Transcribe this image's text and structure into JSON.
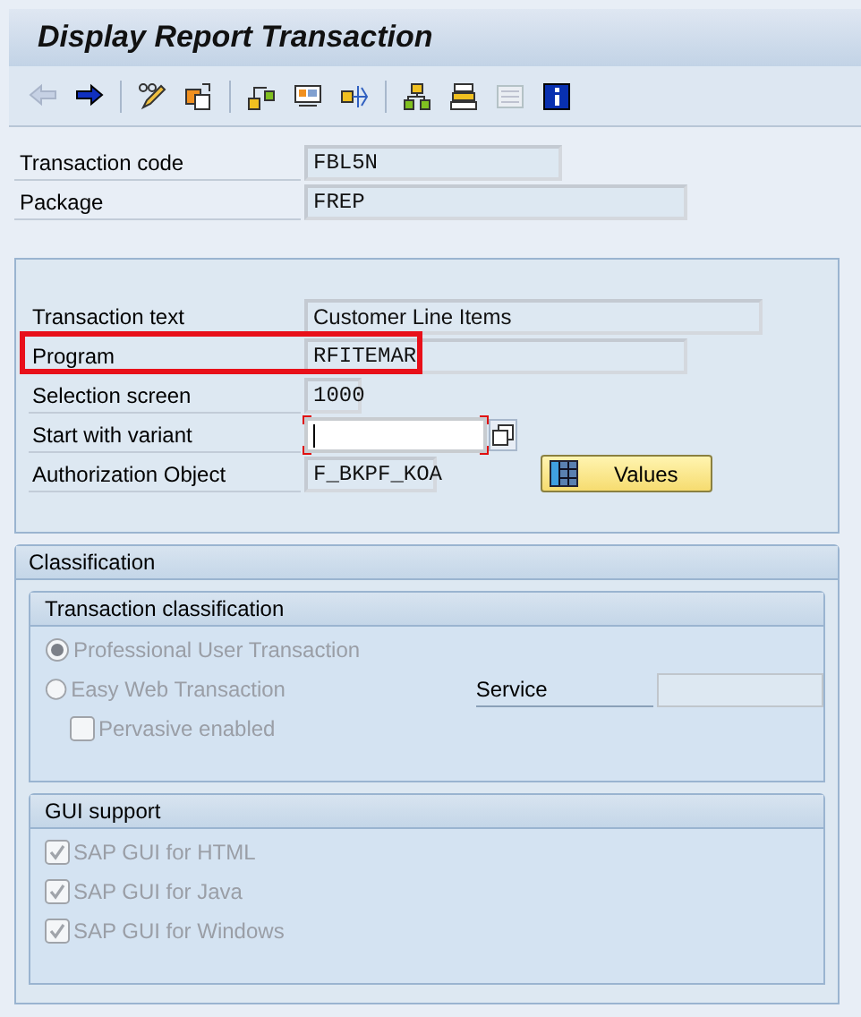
{
  "window": {
    "title": "Display Report Transaction"
  },
  "toolbar": [
    {
      "kind": "back",
      "disabled": true
    },
    {
      "kind": "forward",
      "disabled": false
    },
    {
      "kind": "sep"
    },
    {
      "kind": "edit",
      "disabled": false
    },
    {
      "kind": "other",
      "disabled": false
    },
    {
      "kind": "sep"
    },
    {
      "kind": "tree",
      "disabled": false
    },
    {
      "kind": "screen",
      "disabled": false
    },
    {
      "kind": "branch",
      "disabled": false
    },
    {
      "kind": "sep"
    },
    {
      "kind": "hierarchy",
      "disabled": false
    },
    {
      "kind": "stack",
      "disabled": false
    },
    {
      "kind": "list",
      "disabled": true
    },
    {
      "kind": "info",
      "disabled": false
    }
  ],
  "header_fields": [
    {
      "label": "Transaction code",
      "value": "FBL5N"
    },
    {
      "label": "Package",
      "value": "FREP"
    }
  ],
  "details": [
    {
      "kind": "text",
      "label": "Transaction text",
      "value": "Customer Line Items",
      "highlighted": false
    },
    {
      "kind": "code",
      "label": "Program",
      "value": "RFITEMAR",
      "highlighted": true
    },
    {
      "kind": "code",
      "label": "Selection screen",
      "value": "1000",
      "highlighted": false
    },
    {
      "kind": "variant",
      "label": "Start with variant",
      "focused": true,
      "highlighted": false
    },
    {
      "kind": "auth",
      "label": "Authorization Object",
      "value": "F_BKPF_KOA",
      "button": "Values",
      "highlighted": false
    }
  ],
  "classification": {
    "title": "Classification",
    "transaction_classification": {
      "title": "Transaction classification",
      "options": [
        {
          "label": "Professional User Transaction",
          "selected": true,
          "disabled": true
        },
        {
          "label": "Easy Web Transaction",
          "selected": false,
          "disabled": true
        }
      ],
      "service_label": "Service",
      "pervasive": {
        "label": "Pervasive enabled",
        "checked": false,
        "disabled": true
      }
    },
    "gui_support": {
      "title": "GUI support",
      "options": [
        {
          "label": "SAP GUI for HTML",
          "checked": true,
          "disabled": true
        },
        {
          "label": "SAP GUI for Java",
          "checked": true,
          "disabled": true
        },
        {
          "label": "SAP GUI for Windows",
          "checked": true,
          "disabled": true
        }
      ]
    }
  }
}
